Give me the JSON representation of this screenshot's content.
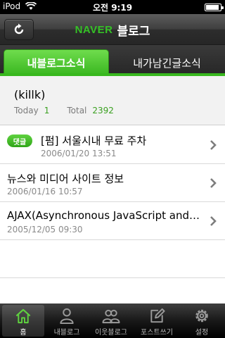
{
  "status_bar": {
    "carrier": "iPod",
    "time": "오전 9:19",
    "battery_level": 0.9
  },
  "nav": {
    "logo": "NAVER",
    "title": "블로그",
    "refresh_icon": "refresh-icon"
  },
  "tabs": [
    {
      "label": "내블로그소식",
      "active": true
    },
    {
      "label": "내가남긴글소식",
      "active": false
    }
  ],
  "profile": {
    "name": "(killk)",
    "today_label": "Today",
    "today_value": "1",
    "total_label": "Total",
    "total_value": "2392"
  },
  "posts": [
    {
      "badge": "댓글",
      "title": "[펌] 서울시내 무료 주차",
      "date": "2006/01/20 13:51"
    },
    {
      "badge": "",
      "title": "뉴스와 미디어 사이트 정보",
      "date": "2006/01/16 10:57"
    },
    {
      "badge": "",
      "title": "AJAX(Asynchronous JavaScript and XML)",
      "date": "2005/12/05 09:30"
    }
  ],
  "tabbar": [
    {
      "label": "홈",
      "icon": "home-icon",
      "active": true
    },
    {
      "label": "내블로그",
      "icon": "person-icon",
      "active": false
    },
    {
      "label": "이웃블로그",
      "icon": "people-icon",
      "active": false
    },
    {
      "label": "포스트쓰기",
      "icon": "compose-icon",
      "active": false
    },
    {
      "label": "설정",
      "icon": "gear-icon",
      "active": false
    }
  ],
  "colors": {
    "accent_green": "#38b81e",
    "count_green": "#3aa020"
  }
}
